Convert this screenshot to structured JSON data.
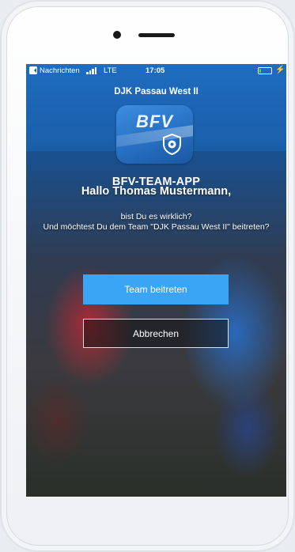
{
  "status_bar": {
    "back_app": "Nachrichten",
    "network": "LTE",
    "time": "17:05",
    "battery_level": 0.15,
    "battery_color": "#4cd964"
  },
  "nav": {
    "title": "DJK Passau West II"
  },
  "app_icon": {
    "logo_text": "BFV",
    "icon": "shield-soccer-icon"
  },
  "content": {
    "brand": "BFV-TEAM-APP",
    "greeting": "Hallo Thomas Mustermann,",
    "question_line1": "bist Du es wirklich?",
    "question_line2": "Und möchtest Du dem Team \"DJK Passau West II\" beitreten?"
  },
  "buttons": {
    "join_label": "Team beitreten",
    "cancel_label": "Abbrechen"
  },
  "colors": {
    "accent": "#3aa4f5",
    "header_blue": "#1a5ea8"
  }
}
